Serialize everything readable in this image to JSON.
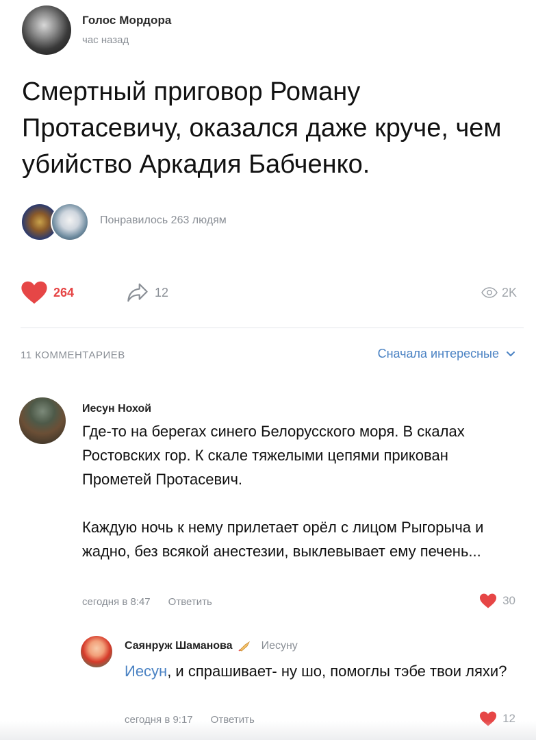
{
  "post": {
    "author": "Голос Мордора",
    "time": "час назад",
    "text": "Смертный приговор Роману Протасевичу, оказался даже круче, чем убийство Аркадия Бабченко.",
    "liked_by_text": "Понравилось 263 людям",
    "likes": "264",
    "shares": "12",
    "views": "2K"
  },
  "comments_header": {
    "count_label": "11 КОММЕНТАРИЕВ",
    "sort_label": "Сначала интересные"
  },
  "comments": [
    {
      "author": "Иесун Нохой",
      "text_p1": "Где-то на берегах синего Белорусского моря. В скалах Ростовских гор. К скале тяжелыми цепями прикован Прометей Протасевич.",
      "text_p2": "Каждую ночь к нему прилетает орёл с лицом Рыгорыча и жадно, без всякой анестезии, выклевывает ему печень...",
      "time": "сегодня в 8:47",
      "reply_label": "Ответить",
      "likes": "30"
    },
    {
      "author": "Саянруж Шаманова",
      "reply_to": "Иесуну",
      "mention": "Иесун",
      "text": ", и спрашивает- ну шо, помоглы тэбе твои ляхи?",
      "time": "сегодня в 9:17",
      "reply_label": "Ответить",
      "likes": "12"
    }
  ],
  "colors": {
    "accent": "#4a82c3",
    "like_red": "#e64646",
    "muted": "#8a8f96"
  },
  "icons": [
    "heart-icon",
    "share-icon",
    "eye-icon",
    "chevron-down-icon",
    "rocket-icon"
  ]
}
